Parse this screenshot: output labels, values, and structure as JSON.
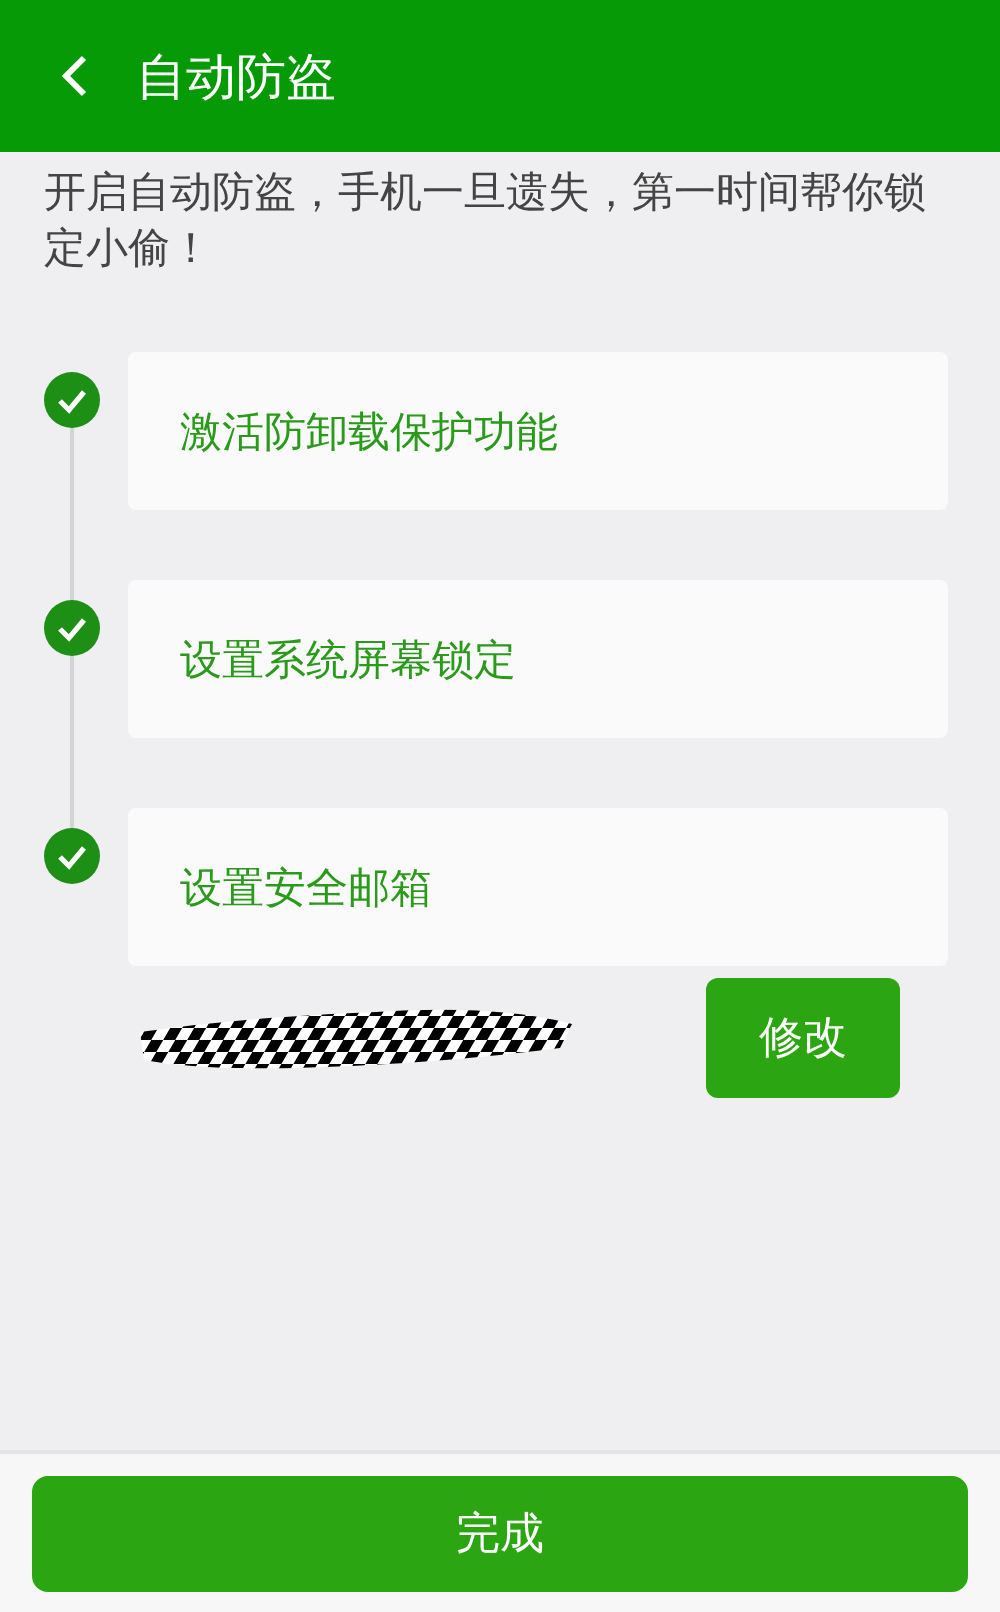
{
  "header": {
    "title": "自动防盗"
  },
  "intro": "开启自动防盗，手机一旦遗失，第一时间帮你锁定小偷！",
  "steps": [
    {
      "label": "激活防卸载保护功能",
      "checked": true
    },
    {
      "label": "设置系统屏幕锁定",
      "checked": true
    },
    {
      "label": "设置安全邮箱",
      "checked": true
    }
  ],
  "email": {
    "edit_button": "修改"
  },
  "done_button": "完成"
}
